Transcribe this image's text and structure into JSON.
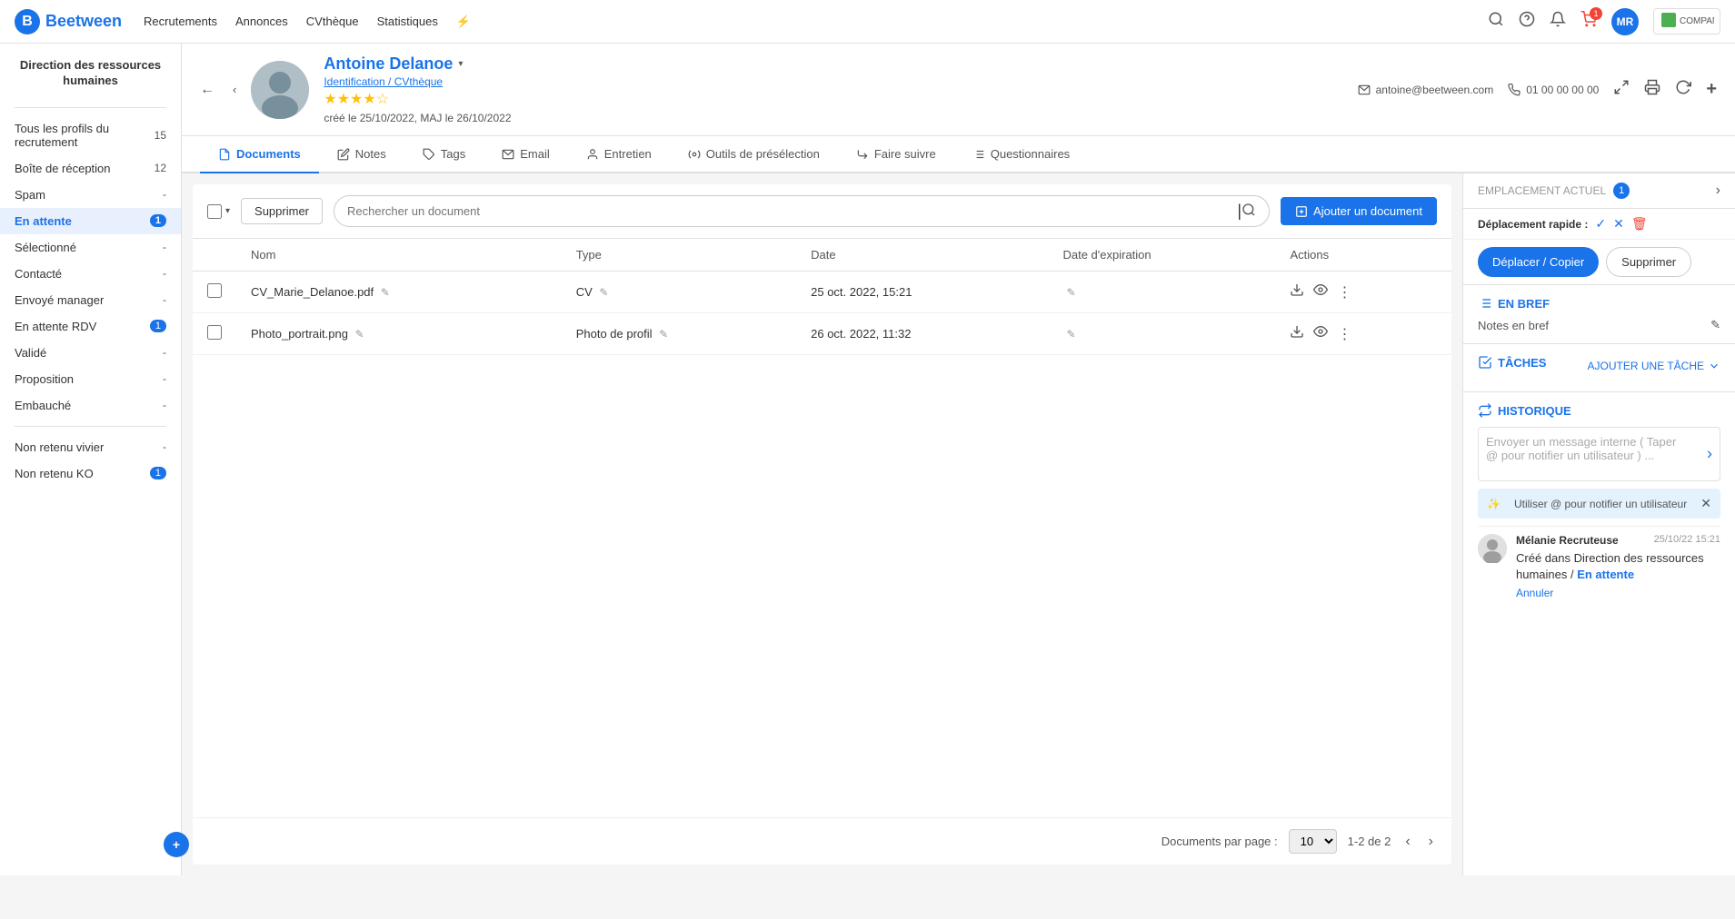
{
  "app": {
    "name": "Beetween",
    "logo_letter": "B"
  },
  "nav": {
    "links": [
      "Recrutements",
      "Annonces",
      "CVthèque",
      "Statistiques"
    ],
    "lightning": "⚡",
    "avatar_initials": "MR",
    "company": "COMPANY",
    "notifications_count": "1"
  },
  "sidebar": {
    "title": "Direction des ressources humaines",
    "items": [
      {
        "label": "Tous les profils du recrutement",
        "count": "15",
        "active": false
      },
      {
        "label": "Boîte de réception",
        "count": "12",
        "active": false
      },
      {
        "label": "Spam",
        "count": "-",
        "active": false
      },
      {
        "label": "En attente",
        "count": "1",
        "active": true
      },
      {
        "label": "Sélectionné",
        "count": "-",
        "active": false
      },
      {
        "label": "Contacté",
        "count": "-",
        "active": false
      },
      {
        "label": "Envoyé manager",
        "count": "-",
        "active": false
      },
      {
        "label": "En attente RDV",
        "count": "1",
        "active": false
      },
      {
        "label": "Validé",
        "count": "-",
        "active": false
      },
      {
        "label": "Proposition",
        "count": "-",
        "active": false
      },
      {
        "label": "Embauché",
        "count": "-",
        "active": false
      },
      {
        "label": "Non retenu vivier",
        "count": "-",
        "active": false
      },
      {
        "label": "Non retenu KO",
        "count": "1",
        "active": false
      }
    ]
  },
  "candidate": {
    "name": "Antoine Delanoe",
    "dropdown_arrow": "▾",
    "link": "Identification / CVthèque",
    "email": "antoine@beetween.com",
    "phone": "01 00 00 00 00",
    "created": "créé le 25/10/2022, MAJ le 26/10/2022",
    "stars": 4,
    "stars_max": 5
  },
  "tabs": [
    {
      "label": "Documents",
      "icon": "📄",
      "active": true
    },
    {
      "label": "Notes",
      "icon": "📝",
      "active": false
    },
    {
      "label": "Tags",
      "icon": "🏷",
      "active": false
    },
    {
      "label": "Email",
      "icon": "✉",
      "active": false
    },
    {
      "label": "Entretien",
      "icon": "👤",
      "active": false
    },
    {
      "label": "Outils de présélection",
      "icon": "⚙",
      "active": false
    },
    {
      "label": "Faire suivre",
      "icon": "↗",
      "active": false
    },
    {
      "label": "Questionnaires",
      "icon": "☰",
      "active": false
    }
  ],
  "documents": {
    "toolbar": {
      "delete_label": "Supprimer",
      "search_placeholder": "Rechercher un document",
      "add_label": "Ajouter un document"
    },
    "table": {
      "columns": [
        "Nom",
        "Type",
        "Date",
        "Date d'expiration",
        "Actions"
      ],
      "rows": [
        {
          "id": 1,
          "name": "CV_Marie_Delanoe.pdf",
          "type": "CV",
          "date": "25 oct. 2022, 15:21",
          "expiry": ""
        },
        {
          "id": 2,
          "name": "Photo_portrait.png",
          "type": "Photo de profil",
          "date": "26 oct. 2022, 11:32",
          "expiry": ""
        }
      ]
    },
    "pagination": {
      "label": "Documents par page :",
      "per_page": "10",
      "range": "1-2 de 2"
    }
  },
  "right_panel": {
    "placement": {
      "title": "EMPLACEMENT ACTUEL",
      "count": "1",
      "rapid_label": "Déplacement rapide :"
    },
    "actions": {
      "move_copy": "Déplacer / Copier",
      "delete": "Supprimer"
    },
    "en_bref": {
      "title": "EN BREF",
      "notes_label": "Notes en bref"
    },
    "taches": {
      "title": "TÂCHES",
      "add_label": "AJOUTER UNE TÂCHE"
    },
    "historique": {
      "title": "HISTORIQUE",
      "input_placeholder": "Envoyer un message interne ( Taper @ pour notifier un utilisateur ) ...",
      "mention_hint": "Utiliser @ pour notifier un utilisateur",
      "entry": {
        "author": "Mélanie Recruteuse",
        "date": "25/10/22 15:21",
        "text_part1": "Créé dans Direction des ressources humaines / ",
        "text_bold": "En attente",
        "annuler": "Annuler"
      }
    }
  }
}
